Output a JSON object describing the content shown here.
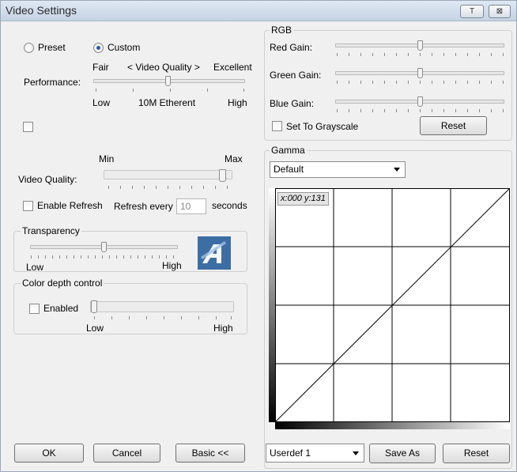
{
  "window": {
    "title": "Video Settings",
    "help_label": "T",
    "close_label": "⊠"
  },
  "mode": {
    "preset_label": "Preset",
    "custom_label": "Custom",
    "selected": "Custom"
  },
  "performance": {
    "label": "Performance:",
    "top_left": "Fair",
    "top_center": "< Video Quality >",
    "top_right": "Excellent",
    "bottom_left": "Low",
    "bottom_center": "10M Etherent",
    "bottom_right": "High",
    "level": 0.5
  },
  "video_quality": {
    "label": "Video Quality:",
    "min_label": "Min",
    "max_label": "Max",
    "level": 1.0
  },
  "refresh": {
    "enable_label": "Enable Refresh",
    "prefix": "Refresh every",
    "value": "10",
    "suffix": "seconds"
  },
  "transparency": {
    "title": "Transparency",
    "low_label": "Low",
    "high_label": "High",
    "level": 0.5
  },
  "color_depth": {
    "title": "Color depth control",
    "enabled_label": "Enabled",
    "low_label": "Low",
    "high_label": "High",
    "level": 0.0
  },
  "rgb": {
    "title": "RGB",
    "red_label": "Red Gain:",
    "green_label": "Green Gain:",
    "blue_label": "Blue Gain:",
    "red_level": 0.5,
    "green_level": 0.5,
    "blue_level": 0.5,
    "grayscale_label": "Set To Grayscale",
    "reset_label": "Reset"
  },
  "gamma": {
    "title": "Gamma",
    "preset_value": "Default",
    "coord_x_label": "x:",
    "coord_x": "000",
    "coord_y_label": "y:",
    "coord_y": "131",
    "curve_value": "Userdef 1",
    "save_as_label": "Save As",
    "reset_label": "Reset"
  },
  "footer": {
    "ok_label": "OK",
    "cancel_label": "Cancel",
    "basic_label": "Basic <<"
  }
}
